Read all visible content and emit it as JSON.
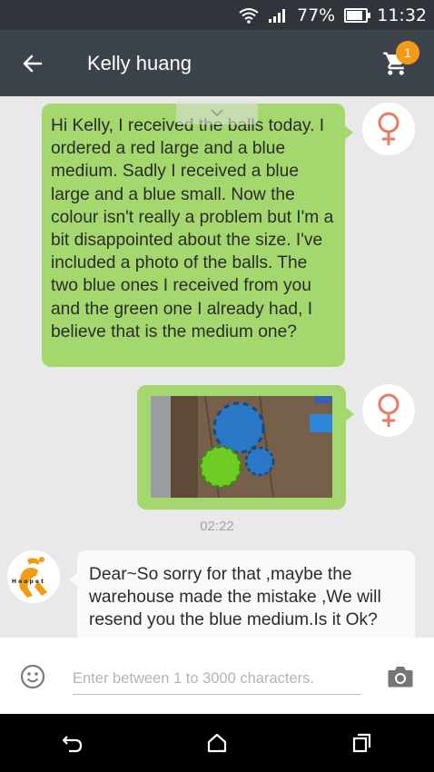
{
  "status_bar": {
    "battery": "77%",
    "time": "11:32",
    "icons": [
      "wifi-icon",
      "signal-icon",
      "battery-icon"
    ]
  },
  "app_bar": {
    "title": "Kelly huang",
    "cart_count": "1",
    "icons": [
      "back-arrow-icon",
      "cart-icon"
    ]
  },
  "messages": [
    {
      "direction": "outgoing",
      "type": "text",
      "text": "Hi Kelly, I received the balls today. I ordered a red large and a blue medium. Sadly I received a blue large and a blue small. Now the colour isn't really a problem but I'm a bit disappointed about the size. I've included a photo of the balls. The two blue ones I received from you and the green one I already had, I believe that is the medium one?",
      "avatar_icon": "female-symbol-icon"
    },
    {
      "direction": "outgoing",
      "type": "image",
      "image_description": "photo-thumbnail",
      "avatar_icon": "female-symbol-icon"
    },
    {
      "direction": "incoming",
      "type": "text",
      "text": "Dear~So sorry for that ,maybe the warehouse made the mistake ,We will resend you the blue medium.Is it Ok?",
      "avatar_icon": "shop-logo-icon",
      "avatar_text": "Hoopet"
    }
  ],
  "timestamp": "02:22",
  "input_bar": {
    "placeholder": "Enter between 1 to 3000 characters.",
    "value": "",
    "icons": [
      "emoji-icon",
      "camera-icon"
    ]
  },
  "nav_bar": {
    "icons": [
      "back-nav-icon",
      "home-nav-icon",
      "recents-nav-icon"
    ]
  },
  "colors": {
    "status_bar_bg": "#2f353b",
    "app_bar_bg": "#3d434a",
    "chat_bg": "#e9e9e9",
    "outgoing_bubble": "#a4d86e",
    "incoming_bubble": "#fafafa",
    "badge": "#f49a1b",
    "female_symbol": "#ea7a61"
  }
}
